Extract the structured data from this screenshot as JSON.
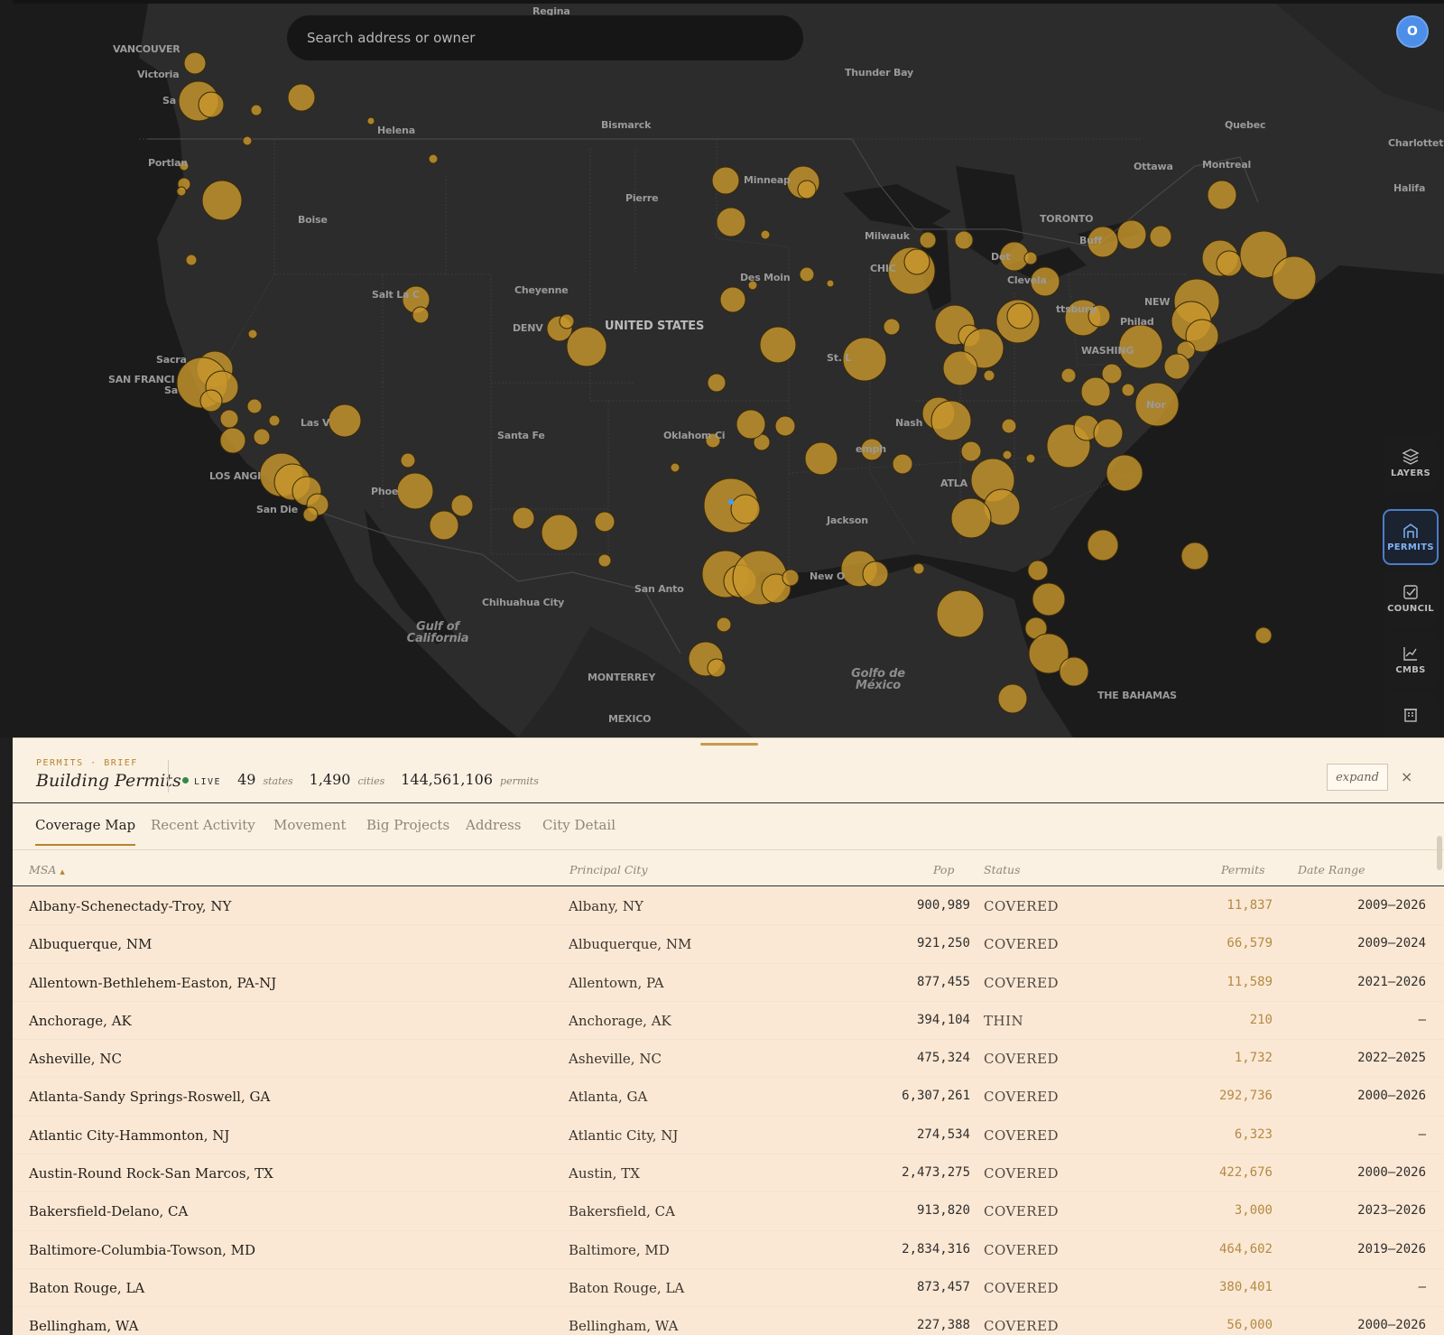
{
  "search": {
    "placeholder": "Search address or owner"
  },
  "avatar": {
    "initial": "O"
  },
  "map_labels": {
    "countries": [
      "UNITED STATES"
    ],
    "cities": [
      "Regina",
      "VANCOUVER",
      "Victoria",
      "Sa",
      "Portlan",
      "Helena",
      "Bismarck",
      "Thunder Bay",
      "Quebec",
      "Charlottet",
      "Halifa",
      "Ottawa",
      "Montreal",
      "TORONTO",
      "Buff",
      "Minneap",
      "Pierre",
      "Boise",
      "Milwauk",
      "Det",
      "CHIC",
      "Clevela",
      "Des Moin",
      "NEW",
      "Cheyenne",
      "Salt La C",
      "DENV",
      "ttsburg",
      "Philad",
      "WASHING",
      "Sacra",
      "SAN FRANCI",
      "Sa",
      "St. L",
      "Las V",
      "Nash",
      "Nor",
      "Santa Fe",
      "Oklahom Ci",
      "emph",
      "LOS ANGI",
      "ATLA",
      "Phoe",
      "San Die",
      "Jackson",
      "San Anto",
      "New O",
      "Chihuahua City",
      "MONTERREY",
      "MEXICO",
      "THE BAHAMAS"
    ],
    "water": [
      "Gulf of California",
      "Golfo de México"
    ]
  },
  "rail": {
    "buttons": [
      {
        "label": "LAYERS",
        "icon": "layers-icon"
      },
      {
        "label": "PERMITS",
        "icon": "permits-icon"
      },
      {
        "label": "COUNCIL",
        "icon": "council-icon"
      },
      {
        "label": "CMBS",
        "icon": "chart-icon"
      }
    ]
  },
  "drawer": {
    "kicker": "PERMITS · BRIEF",
    "title": "Building Permits",
    "live_label": "LIVE",
    "stats": {
      "states": "49",
      "states_unit": "states",
      "cities": "1,490",
      "cities_unit": "cities",
      "permits": "144,561,106",
      "permits_unit": "permits"
    },
    "expand_label": "expand",
    "close_label": "×",
    "tabs": [
      "Coverage Map",
      "Recent Activity",
      "Movement",
      "Big Projects",
      "Address",
      "City Detail"
    ],
    "active_tab": "Coverage Map",
    "columns": {
      "msa": "MSA",
      "sort_glyph": "▲",
      "principal_city": "Principal City",
      "pop": "Pop",
      "status": "Status",
      "permits": "Permits",
      "date_range": "Date Range"
    },
    "rows": [
      {
        "msa": "Albany-Schenectady-Troy, NY",
        "city": "Albany, NY",
        "pop": "900,989",
        "status": "COVERED",
        "permits": "11,837",
        "range": "2009–2026"
      },
      {
        "msa": "Albuquerque, NM",
        "city": "Albuquerque, NM",
        "pop": "921,250",
        "status": "COVERED",
        "permits": "66,579",
        "range": "2009–2024"
      },
      {
        "msa": "Allentown-Bethlehem-Easton, PA-NJ",
        "city": "Allentown, PA",
        "pop": "877,455",
        "status": "COVERED",
        "permits": "11,589",
        "range": "2021–2026"
      },
      {
        "msa": "Anchorage, AK",
        "city": "Anchorage, AK",
        "pop": "394,104",
        "status": "THIN",
        "permits": "210",
        "range": "–"
      },
      {
        "msa": "Asheville, NC",
        "city": "Asheville, NC",
        "pop": "475,324",
        "status": "COVERED",
        "permits": "1,732",
        "range": "2022–2025"
      },
      {
        "msa": "Atlanta-Sandy Springs-Roswell, GA",
        "city": "Atlanta, GA",
        "pop": "6,307,261",
        "status": "COVERED",
        "permits": "292,736",
        "range": "2000–2026"
      },
      {
        "msa": "Atlantic City-Hammonton, NJ",
        "city": "Atlantic City, NJ",
        "pop": "274,534",
        "status": "COVERED",
        "permits": "6,323",
        "range": "–"
      },
      {
        "msa": "Austin-Round Rock-San Marcos, TX",
        "city": "Austin, TX",
        "pop": "2,473,275",
        "status": "COVERED",
        "permits": "422,676",
        "range": "2000–2026"
      },
      {
        "msa": "Bakersfield-Delano, CA",
        "city": "Bakersfield, CA",
        "pop": "913,820",
        "status": "COVERED",
        "permits": "3,000",
        "range": "2023–2026"
      },
      {
        "msa": "Baltimore-Columbia-Towson, MD",
        "city": "Baltimore, MD",
        "pop": "2,834,316",
        "status": "COVERED",
        "permits": "464,602",
        "range": "2019–2026"
      },
      {
        "msa": "Baton Rouge, LA",
        "city": "Baton Rouge, LA",
        "pop": "873,457",
        "status": "COVERED",
        "permits": "380,401",
        "range": "–"
      },
      {
        "msa": "Bellingham, WA",
        "city": "Bellingham, WA",
        "pop": "227,388",
        "status": "COVERED",
        "permits": "56,000",
        "range": "2000–2026"
      }
    ]
  },
  "colors": {
    "bubble": "#c7962c",
    "drawer_bg": "#fbf1e3",
    "accent": "#b7842f",
    "active_blue": "#4a7ec8"
  }
}
